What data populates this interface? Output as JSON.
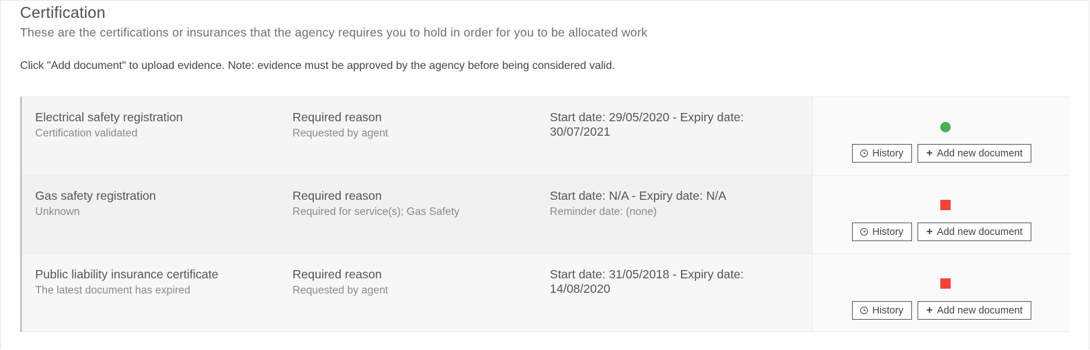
{
  "certification": {
    "title": "Certification",
    "subtitle": "These are the certifications or insurances that the agency requires you to hold in order for you to be allocated work",
    "instruction": "Click \"Add document\" to upload evidence. Note: evidence must be approved by the agency before being considered valid."
  },
  "items": [
    {
      "name": "Electrical safety registration",
      "status_text": "Certification validated",
      "reason_label": "Required reason",
      "reason": "Requested by agent",
      "dates": "Start date: 29/05/2020 - Expiry date: 30/07/2021",
      "reminder": "",
      "status": "valid",
      "status_color": "#4caf50",
      "history_label": "History",
      "add_label": "Add new document"
    },
    {
      "name": "Gas safety registration",
      "status_text": "Unknown",
      "reason_label": "Required reason",
      "reason": "Required for service(s); Gas Safety",
      "dates": "Start date: N/A - Expiry date: N/A",
      "reminder": "Reminder date: (none)",
      "status": "invalid",
      "status_color": "#f44336",
      "history_label": "History",
      "add_label": "Add new document"
    },
    {
      "name": "Public liability insurance certificate",
      "status_text": "The latest document has expired",
      "reason_label": "Required reason",
      "reason": "Requested by agent",
      "dates": "Start date: 31/05/2018 - Expiry date: 14/08/2020",
      "reminder": "",
      "status": "invalid",
      "status_color": "#f44336",
      "history_label": "History",
      "add_label": "Add new document"
    }
  ],
  "icons": {
    "history": "clock-icon",
    "add": "plus-icon",
    "status_valid": "green-circle-icon",
    "status_invalid": "red-square-icon"
  }
}
